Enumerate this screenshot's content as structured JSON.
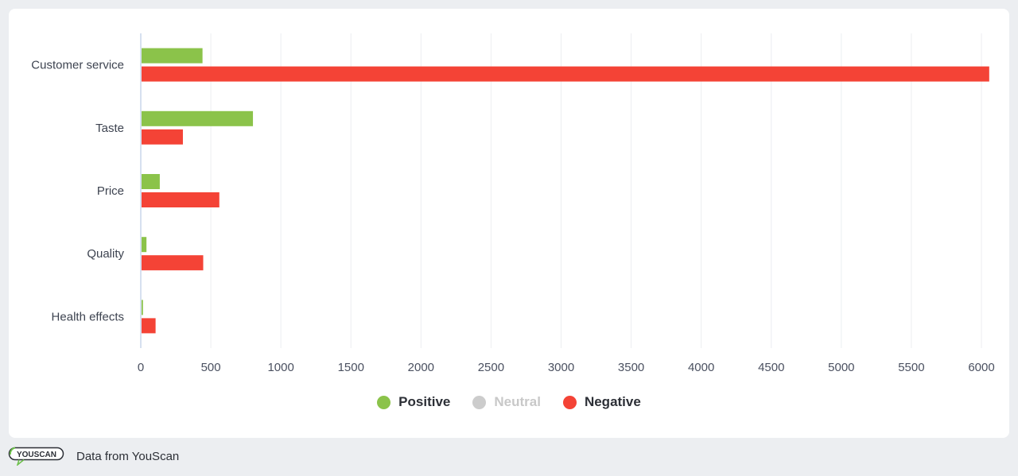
{
  "chart_data": {
    "type": "bar",
    "orientation": "horizontal",
    "title": "",
    "xlabel": "",
    "ylabel": "",
    "categories": [
      "Customer service",
      "Taste",
      "Price",
      "Quality",
      "Health effects"
    ],
    "series": [
      {
        "name": "Positive",
        "color": "#8bc34a",
        "values": [
          435,
          795,
          130,
          35,
          10
        ],
        "visible": true
      },
      {
        "name": "Neutral",
        "color": "#cccccc",
        "values": [
          0,
          0,
          0,
          0,
          0
        ],
        "visible": false
      },
      {
        "name": "Negative",
        "color": "#f44336",
        "values": [
          6050,
          295,
          555,
          440,
          100
        ],
        "visible": true
      }
    ],
    "xlim": [
      0,
      6000
    ],
    "xticks": [
      "0",
      "500",
      "1000",
      "1500",
      "2000",
      "2500",
      "3000",
      "3500",
      "4000",
      "4500",
      "5000",
      "5500",
      "6000"
    ],
    "grid": true,
    "legend_position": "bottom"
  },
  "legend": [
    {
      "label": "Positive",
      "color": "#8bc34a",
      "text_color": "#2c2f36"
    },
    {
      "label": "Neutral",
      "color": "#cccccc",
      "text_color": "#c8c8c8"
    },
    {
      "label": "Negative",
      "color": "#f44336",
      "text_color": "#2c2f36"
    }
  ],
  "footer": {
    "logo_text": "YOUSCAN",
    "text": "Data from YouScan"
  }
}
